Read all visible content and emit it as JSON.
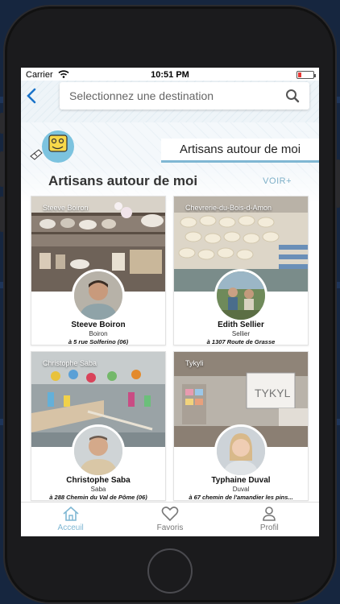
{
  "status_bar": {
    "carrier": "Carrier",
    "time": "10:51 PM",
    "battery_level": 0.15,
    "battery_color": "#e53935"
  },
  "search": {
    "placeholder": "Selectionnez une destination"
  },
  "tab": {
    "label": "Artisans autour de moi"
  },
  "section": {
    "title": "Artisans autour de moi",
    "more_link": "VOIR+"
  },
  "artisans": [
    {
      "shop": "Steeve Boiron",
      "name": "Steeve Boiron",
      "subtitle": "Boiron",
      "address": "à 5 rue Solferino (06)"
    },
    {
      "shop": "Chevrerie-du-Bois-d-Amon",
      "name": "Edith Sellier",
      "subtitle": "Sellier",
      "address": "à 1307 Route de Grasse"
    },
    {
      "shop": "Christophe Saba",
      "name": "Christophe Saba",
      "subtitle": "Saba",
      "address": "à 288 Chemin du Val de Pôme (06)"
    },
    {
      "shop": "Tykyli",
      "name": "Typhaine Duval",
      "subtitle": "Duval",
      "address": "à 67 chemin de l'amandier les pins..."
    }
  ],
  "bottom_tabs": [
    {
      "label": "Acceuil",
      "icon": "home-icon",
      "active": true
    },
    {
      "label": "Favoris",
      "icon": "heart-icon",
      "active": false
    },
    {
      "label": "Profil",
      "icon": "person-icon",
      "active": false
    }
  ],
  "colors": {
    "accent": "#1a73c9",
    "tab_active": "#7fb7d3",
    "tab_inactive": "#777777",
    "brand_yellow": "#f7d84a",
    "brand_blue": "#7cc3df"
  }
}
